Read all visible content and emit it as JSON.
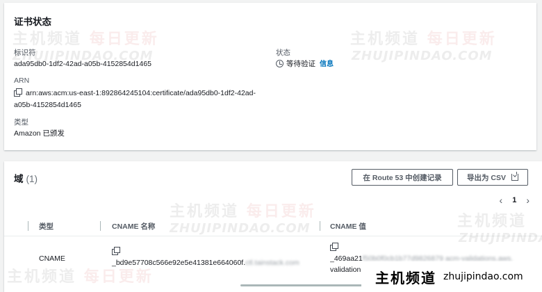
{
  "status_panel": {
    "title": "证书状态",
    "identifier": {
      "label": "标识符",
      "value": "ada95db0-1df2-42ad-a05b-4152854d1465"
    },
    "status": {
      "label": "状态",
      "value": "等待验证",
      "info_link": "信息"
    },
    "arn": {
      "label": "ARN",
      "value_line1": "arn:aws:acm:us-east-1:892864245104:certificate/ada95db0-1df2-42ad-",
      "value_line2": "a05b-4152854d1465"
    },
    "type": {
      "label": "类型",
      "value": "Amazon 已颁发"
    }
  },
  "domains_panel": {
    "title": "域",
    "count": "(1)",
    "route53_button": "在 Route 53 中创建记录",
    "export_csv_button": "导出为 CSV",
    "pagination": {
      "prev": "‹",
      "page": "1",
      "next": "›"
    },
    "columns": [
      "类型",
      "CNAME 名称",
      "CNAME 值"
    ],
    "rows": [
      {
        "type": "CNAME",
        "cname_name_visible": "_bd9e57708c566e92e5e41381e664060f.",
        "cname_name_hidden": "ctl.tainstack.com",
        "cname_value_visible": "_469aa21",
        "cname_value_hidden": "f50b0f0cb1b77d9826879 acm-validations.aws.",
        "cname_value_line2": "validation"
      }
    ]
  },
  "watermarks": {
    "cn_main": "主机频道",
    "cn_sub": "每日更新",
    "en": "ZHUJIPINDAO.COM"
  },
  "site_badge": {
    "cn": "主机频道",
    "url": "zhujipindao.com"
  },
  "icons": [
    "copy-icon",
    "clock-icon",
    "download-icon",
    "chevron-left-icon",
    "chevron-right-icon"
  ]
}
